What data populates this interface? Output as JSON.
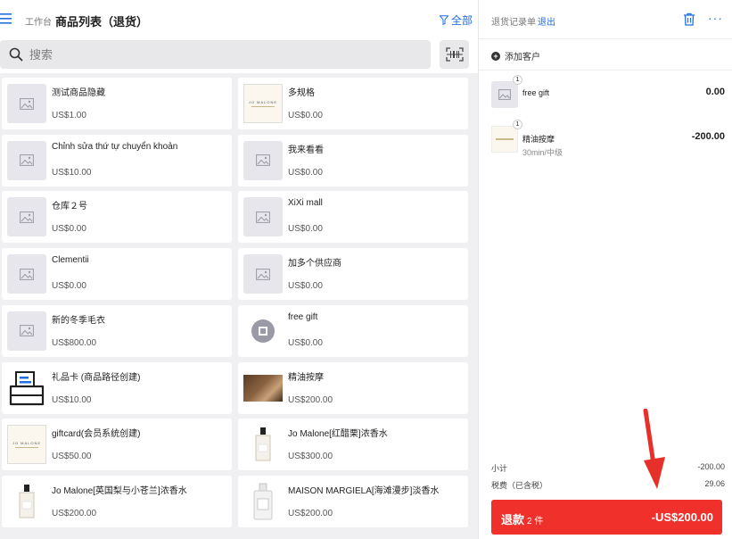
{
  "header": {
    "workbench": "工作台",
    "title": "商品列表（退货）",
    "filter_label": "全部"
  },
  "search": {
    "placeholder": "搜索"
  },
  "products": [
    {
      "name": "测试商品隐藏",
      "price": "US$1.00",
      "thumb": "placeholder"
    },
    {
      "name": "多规格",
      "price": "US$0.00",
      "thumb": "jo-malone-box"
    },
    {
      "name": "Chỉnh sửa thứ tự chuyển khoản",
      "price": "US$10.00",
      "thumb": "placeholder"
    },
    {
      "name": "我来看看",
      "price": "US$0.00",
      "thumb": "placeholder"
    },
    {
      "name": "仓库２号",
      "price": "US$0.00",
      "thumb": "placeholder"
    },
    {
      "name": "XiXi mall",
      "price": "US$0.00",
      "thumb": "placeholder"
    },
    {
      "name": "Clementii",
      "price": "US$0.00",
      "thumb": "placeholder"
    },
    {
      "name": "加多个供应商",
      "price": "US$0.00",
      "thumb": "placeholder"
    },
    {
      "name": "新的冬季毛衣",
      "price": "US$800.00",
      "thumb": "placeholder"
    },
    {
      "name": "free gift",
      "price": "US$0.00",
      "thumb": "gift-circle"
    },
    {
      "name": "礼品卡 (商品路径创建)",
      "price": "US$10.00",
      "thumb": "giftcard-icon"
    },
    {
      "name": "精油按摩",
      "price": "US$200.00",
      "thumb": "massage-photo"
    },
    {
      "name": "giftcard(会员系统创建)",
      "price": "US$50.00",
      "thumb": "jo-malone-box"
    },
    {
      "name": "Jo Malone[红醋栗]浓香水",
      "price": "US$300.00",
      "thumb": "perfume-bottle"
    },
    {
      "name": "Jo Malone[英国梨与小苍兰]浓香水",
      "price": "US$200.00",
      "thumb": "perfume-bottle"
    },
    {
      "name": "MAISON MARGIELA[海滩漫步]淡香水",
      "price": "US$200.00",
      "thumb": "replica-bottle"
    }
  ],
  "order": {
    "title": "退货记录单",
    "exit_label": "退出",
    "more_label": "···",
    "add_customer": "添加客户",
    "items": [
      {
        "qty": "1",
        "name": "free gift",
        "sub": "",
        "amount": "0.00"
      },
      {
        "qty": "1",
        "name": "精油按摩",
        "sub": "30min/中级",
        "amount": "-200.00"
      }
    ],
    "subtotal_label": "小计",
    "subtotal_value": "-200.00",
    "tax_label": "税费（已含税）",
    "tax_value": "29.06",
    "refund_label": "退款",
    "refund_count": "2 件",
    "refund_amount": "-US$200.00"
  },
  "colors": {
    "accent": "#1f6fe3",
    "refund_button": "#f0302a",
    "annotation_arrow": "#e8302a"
  }
}
